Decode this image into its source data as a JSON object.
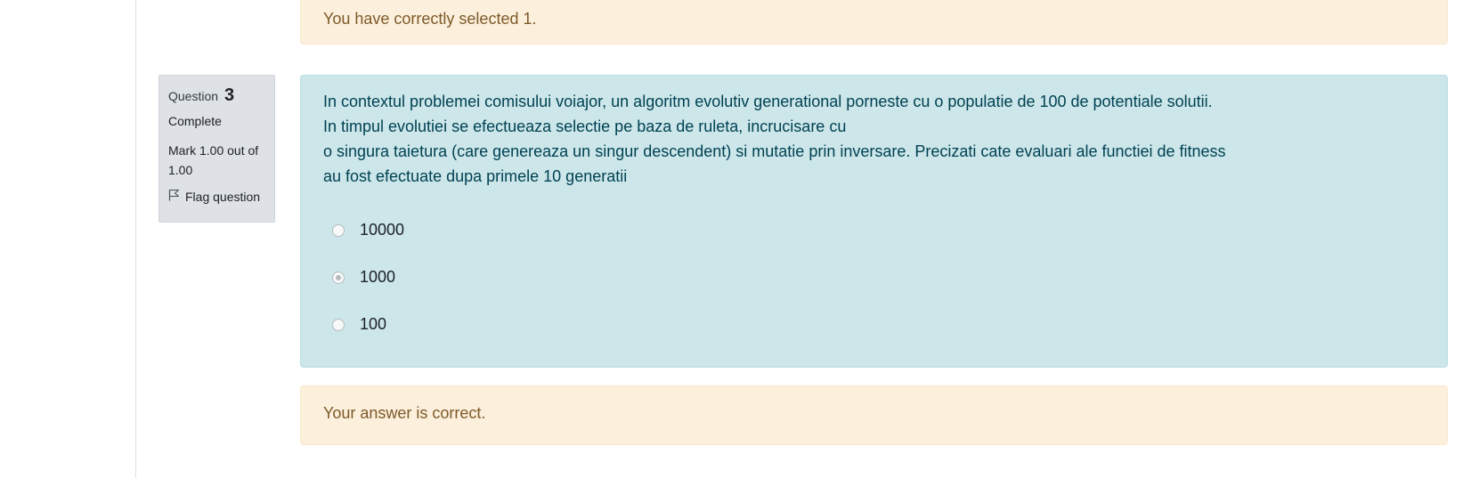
{
  "previous_feedback": {
    "text": "You have correctly selected 1."
  },
  "question": {
    "label": "Question",
    "number": "3",
    "state": "Complete",
    "grade": "Mark 1.00 out of 1.00",
    "flag_label": "Flag question",
    "text_lines": [
      "In contextul problemei comisului voiajor, un algoritm evolutiv generational porneste cu o populatie de 100 de potentiale solutii.",
      "In timpul evolutiei se efectueaza selectie pe baza de ruleta, incrucisare cu",
      "o singura taietura (care genereaza un singur descendent) si mutatie prin inversare. Precizati cate evaluari ale functiei de fitness",
      "au fost efectuate dupa primele 10 generatii"
    ],
    "options": [
      {
        "label": "10000",
        "selected": false
      },
      {
        "label": "1000",
        "selected": true
      },
      {
        "label": "100",
        "selected": false
      }
    ]
  },
  "feedback": {
    "text": "Your answer is correct."
  },
  "colors": {
    "formulation_bg": "#cce6ea",
    "feedback_bg": "#fcefdc",
    "info_bg": "#dee2e6"
  }
}
